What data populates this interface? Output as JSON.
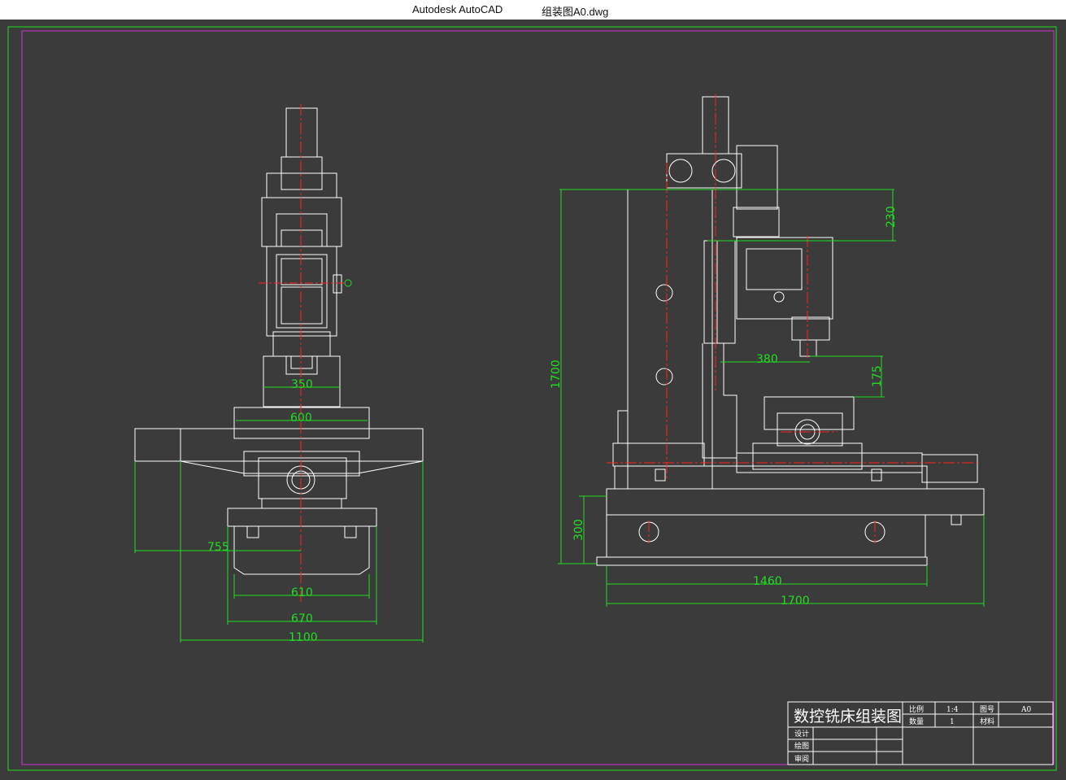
{
  "window": {
    "app_title": "Autodesk AutoCAD",
    "file_title": "组装图A0.dwg"
  },
  "colors": {
    "background": "#3b3b3b",
    "outline": "#ffffff",
    "dimension": "#22dd22",
    "centerline": "#ff2222",
    "frame_inner": "#cc33cc"
  },
  "dimensions": {
    "front": {
      "d350": "350",
      "d600": "600",
      "d755": "755",
      "d610": "610",
      "d670": "670",
      "d1100": "1100"
    },
    "side": {
      "d230": "230",
      "d380": "380",
      "d175": "175",
      "d1700v": "1700",
      "d300": "300",
      "d1460": "1460",
      "d1700h": "1700"
    }
  },
  "title_block": {
    "drawing_title": "数控铣床组装图",
    "scale_label": "比例",
    "scale_value": "1:4",
    "drawing_no_label": "图号",
    "drawing_no_value": "A0",
    "quantity_label": "数量",
    "quantity_value": "1",
    "material_label": "材料",
    "designer_label": "设计",
    "drafter_label": "绘图",
    "reviewer_label": "审阅"
  }
}
